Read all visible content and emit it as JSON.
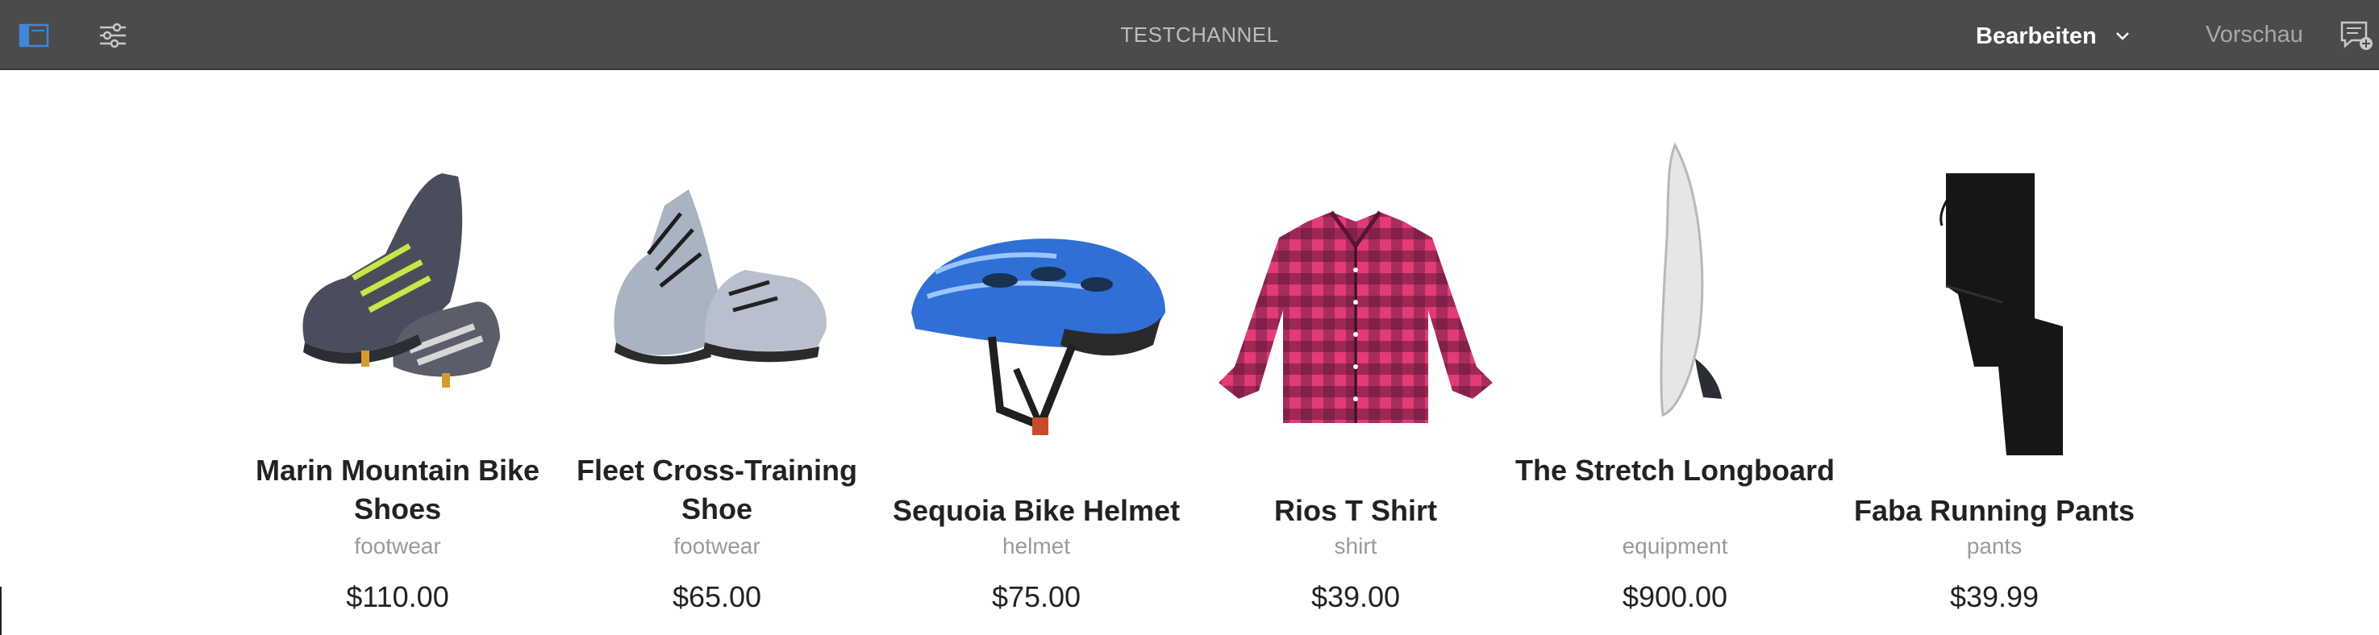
{
  "toolbar": {
    "title": "TESTCHANNEL",
    "mode_label": "Bearbeiten",
    "preview_label": "Vorschau",
    "icons": {
      "side_panel": "side-panel-icon",
      "properties": "sliders-icon",
      "mode_toggle": "chevron-down-icon",
      "annotations": "annotation-icon"
    },
    "colors": {
      "bar": "#4b4b4b",
      "active_icon": "#3f87d8"
    }
  },
  "products": [
    {
      "name": "Marin Mountain Bike Shoes",
      "category": "footwear",
      "price": "$110.00",
      "image_icon": "bike-shoes-image"
    },
    {
      "name": "Fleet Cross-Training Shoe",
      "category": "footwear",
      "price": "$65.00",
      "image_icon": "training-shoes-image"
    },
    {
      "name": "Sequoia Bike Helmet",
      "category": "helmet",
      "price": "$75.00",
      "image_icon": "bike-helmet-image"
    },
    {
      "name": "Rios T Shirt",
      "category": "shirt",
      "price": "$39.00",
      "image_icon": "plaid-shirt-image"
    },
    {
      "name": "The Stretch Longboard",
      "category": "equipment",
      "price": "$900.00",
      "image_icon": "surfboard-image"
    },
    {
      "name": "Faba Running Pants",
      "category": "pants",
      "price": "$39.99",
      "image_icon": "running-pants-image"
    }
  ]
}
